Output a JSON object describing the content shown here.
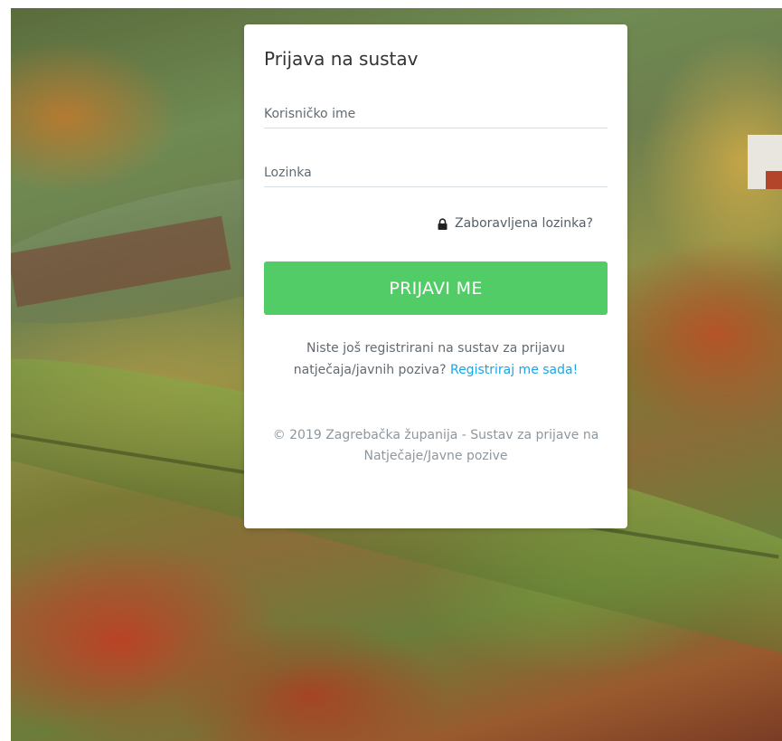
{
  "login": {
    "title": "Prijava na sustav",
    "username_placeholder": "Korisničko ime",
    "password_placeholder": "Lozinka",
    "forgot_password": "Zaboravljena lozinka?",
    "submit_label": "PRIJAVI ME",
    "register_prompt": "Niste još registrirani na sustav za prijavu natječaja/javnih poziva?",
    "register_link": "Registriraj me sada!",
    "copyright": "© 2019 Zagrebačka županija - Sustav za prijave na Natječaje/Javne pozive"
  },
  "colors": {
    "accent_button": "#52cc66",
    "link": "#1aa6e6"
  },
  "icons": {
    "forgot": "lock-icon"
  }
}
